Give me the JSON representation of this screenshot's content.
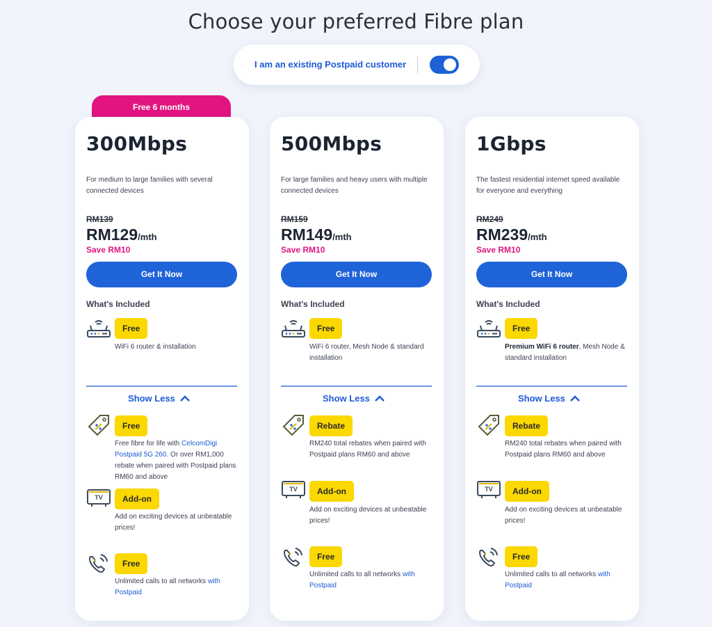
{
  "page": {
    "title": "Choose your preferred Fibre plan",
    "toggle": {
      "label": "I am an existing Postpaid customer",
      "on": true
    }
  },
  "colors": {
    "accent_blue": "#1f63d8",
    "pink": "#e21480",
    "badge_yellow": "#fbd800"
  },
  "plans": [
    {
      "promo": "Free 6 months",
      "speed": "300Mbps",
      "description": "For medium to large families with several connected devices",
      "old_price": "RM139",
      "price": "RM129",
      "unit": "/mth",
      "save": "Save RM10",
      "cta": "Get It Now",
      "included_title": "What's Included",
      "features": [
        {
          "icon": "router-icon",
          "badge": "Free",
          "text": "WiFi 6 router & installation"
        },
        {
          "icon": "price-tag-icon",
          "badge": "Free",
          "text_pre": "Free fibre for life with ",
          "text_link": "CelcomDigi Postpaid 5G 260",
          "text_post": ". Or over RM1,000 rebate when paired with Postpaid plans RM60 and above"
        },
        {
          "icon": "tv-icon",
          "badge": "Add-on",
          "text": "Add on exciting devices at unbeatable prices!"
        },
        {
          "icon": "phone-call-icon",
          "badge": "Free",
          "text_pre": "Unlimited calls to all networks ",
          "text_link": "with Postpaid"
        }
      ],
      "show_less": "Show Less"
    },
    {
      "speed": "500Mbps",
      "description": "For large families and heavy users with multiple connected devices",
      "old_price": "RM159",
      "price": "RM149",
      "unit": "/mth",
      "save": "Save RM10",
      "cta": "Get It Now",
      "included_title": "What's Included",
      "features": [
        {
          "icon": "router-icon",
          "badge": "Free",
          "text": "WiFi 6 router, Mesh Node & standard installation"
        },
        {
          "icon": "price-tag-icon",
          "badge": "Rebate",
          "text": "RM240 total rebates when paired with Postpaid plans RM60 and above"
        },
        {
          "icon": "tv-icon",
          "badge": "Add-on",
          "text": "Add on exciting devices at unbeatable prices!"
        },
        {
          "icon": "phone-call-icon",
          "badge": "Free",
          "text_pre": "Unlimited calls to all networks ",
          "text_link": "with Postpaid"
        }
      ],
      "show_less": "Show Less"
    },
    {
      "speed": "1Gbps",
      "description": "The fastest residential internet speed available for everyone and everything",
      "old_price": "RM249",
      "price": "RM239",
      "unit": "/mth",
      "save": "Save RM10",
      "cta": "Get It Now",
      "included_title": "What's Included",
      "features": [
        {
          "icon": "router-icon",
          "badge": "Free",
          "text_bold": "Premium WiFi 6 router",
          "text_post": ", Mesh Node & standard installation"
        },
        {
          "icon": "price-tag-icon",
          "badge": "Rebate",
          "text": "RM240 total rebates when paired with Postpaid plans RM60 and above"
        },
        {
          "icon": "tv-icon",
          "badge": "Add-on",
          "text": "Add on exciting devices at unbeatable prices!"
        },
        {
          "icon": "phone-call-icon",
          "badge": "Free",
          "text_pre": "Unlimited calls to all networks ",
          "text_link": "with Postpaid"
        }
      ],
      "show_less": "Show Less"
    }
  ]
}
